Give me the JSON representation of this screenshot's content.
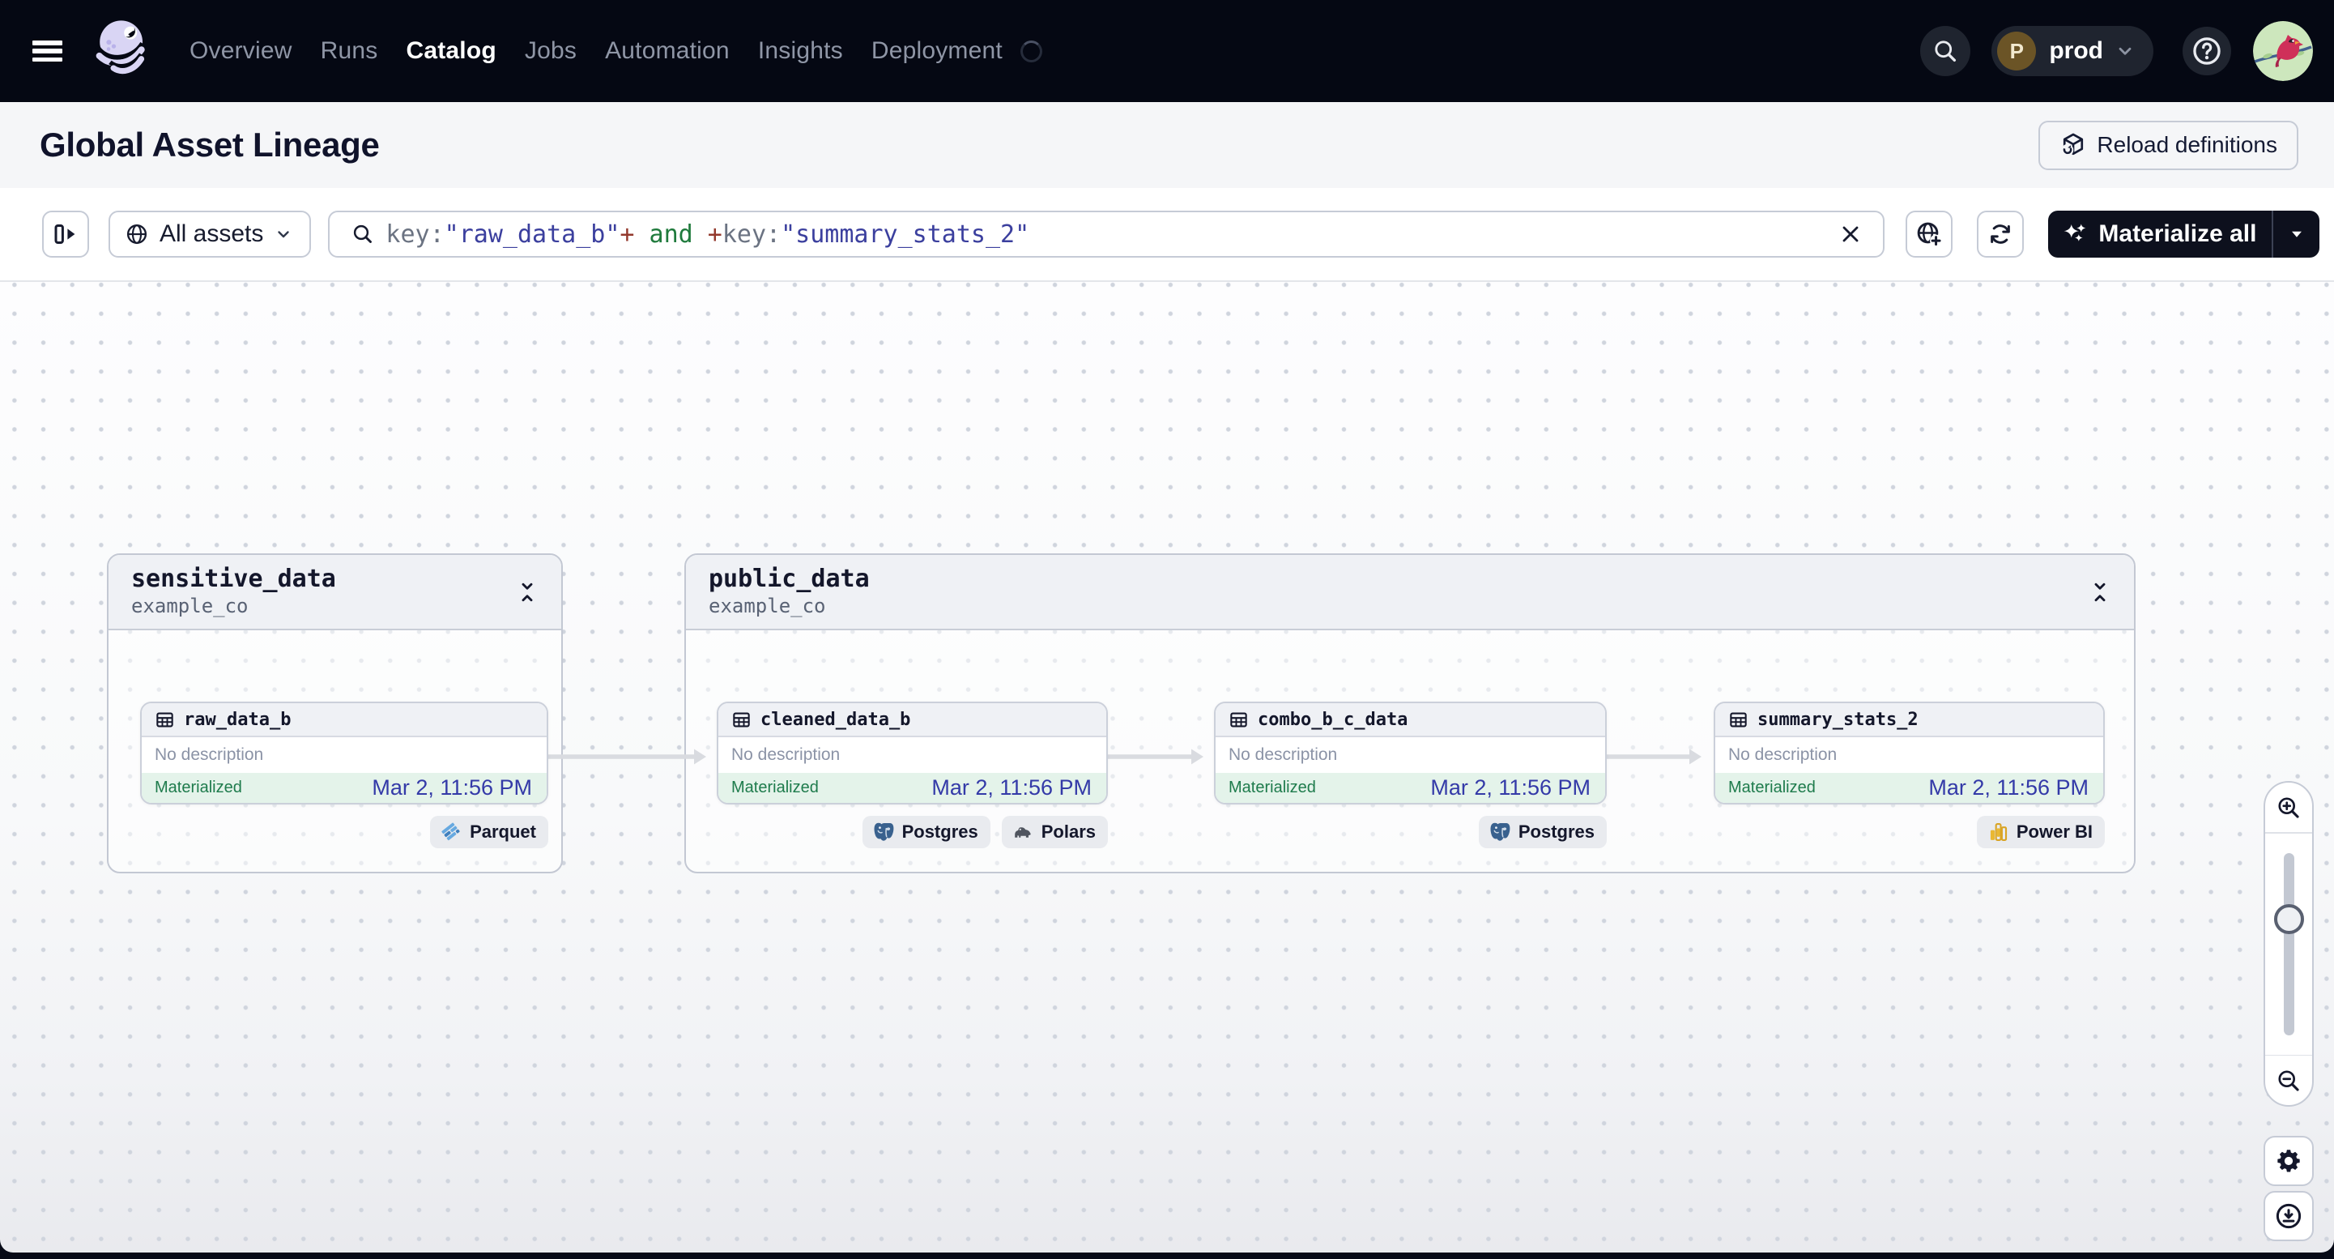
{
  "topnav": {
    "brand": "Dagster",
    "items": [
      {
        "label": "Overview",
        "active": false
      },
      {
        "label": "Runs",
        "active": false
      },
      {
        "label": "Catalog",
        "active": true
      },
      {
        "label": "Jobs",
        "active": false
      },
      {
        "label": "Automation",
        "active": false
      },
      {
        "label": "Insights",
        "active": false
      },
      {
        "label": "Deployment",
        "active": false
      }
    ],
    "deployment_loading": true,
    "workspace": {
      "initial": "P",
      "name": "prod"
    }
  },
  "header": {
    "title": "Global Asset Lineage",
    "reload_label": "Reload definitions"
  },
  "toolbar": {
    "scope_label": "All assets",
    "query": {
      "segments": [
        {
          "text": "key:",
          "kind": "attr"
        },
        {
          "text": "\"raw_data_b\"",
          "kind": "value"
        },
        {
          "text": "+",
          "kind": "op"
        },
        {
          "text": " and ",
          "kind": "bool"
        },
        {
          "text": "+",
          "kind": "op"
        },
        {
          "text": "key:",
          "kind": "attr"
        },
        {
          "text": "\"summary_stats_2\"",
          "kind": "value"
        }
      ]
    },
    "materialize_label": "Materialize all"
  },
  "graph": {
    "groups": [
      {
        "name": "sensitive_data",
        "location": "example_co"
      },
      {
        "name": "public_data",
        "location": "example_co"
      }
    ],
    "nodes": [
      {
        "name": "raw_data_b",
        "description": "No description",
        "status": "Materialized",
        "timestamp": "Mar 2, 11:56 PM",
        "badges": [
          {
            "label": "Parquet",
            "icon": "parquet"
          }
        ]
      },
      {
        "name": "cleaned_data_b",
        "description": "No description",
        "status": "Materialized",
        "timestamp": "Mar 2, 11:56 PM",
        "badges": [
          {
            "label": "Postgres",
            "icon": "postgres"
          },
          {
            "label": "Polars",
            "icon": "polars"
          }
        ]
      },
      {
        "name": "combo_b_c_data",
        "description": "No description",
        "status": "Materialized",
        "timestamp": "Mar 2, 11:56 PM",
        "badges": [
          {
            "label": "Postgres",
            "icon": "postgres"
          }
        ]
      },
      {
        "name": "summary_stats_2",
        "description": "No description",
        "status": "Materialized",
        "timestamp": "Mar 2, 11:56 PM",
        "badges": [
          {
            "label": "Power BI",
            "icon": "powerbi"
          }
        ]
      }
    ]
  },
  "colors": {
    "status_materialized": "#1e7b4c",
    "status_band": "#e4f3ea",
    "timestamp": "#343aa8",
    "query_attr": "#6b7382",
    "query_value": "#3b3f9e",
    "query_op": "#93392c",
    "query_bool": "#1f7a3c",
    "navbar_bg": "#050813",
    "accent_dark_button": "#0d101d"
  }
}
